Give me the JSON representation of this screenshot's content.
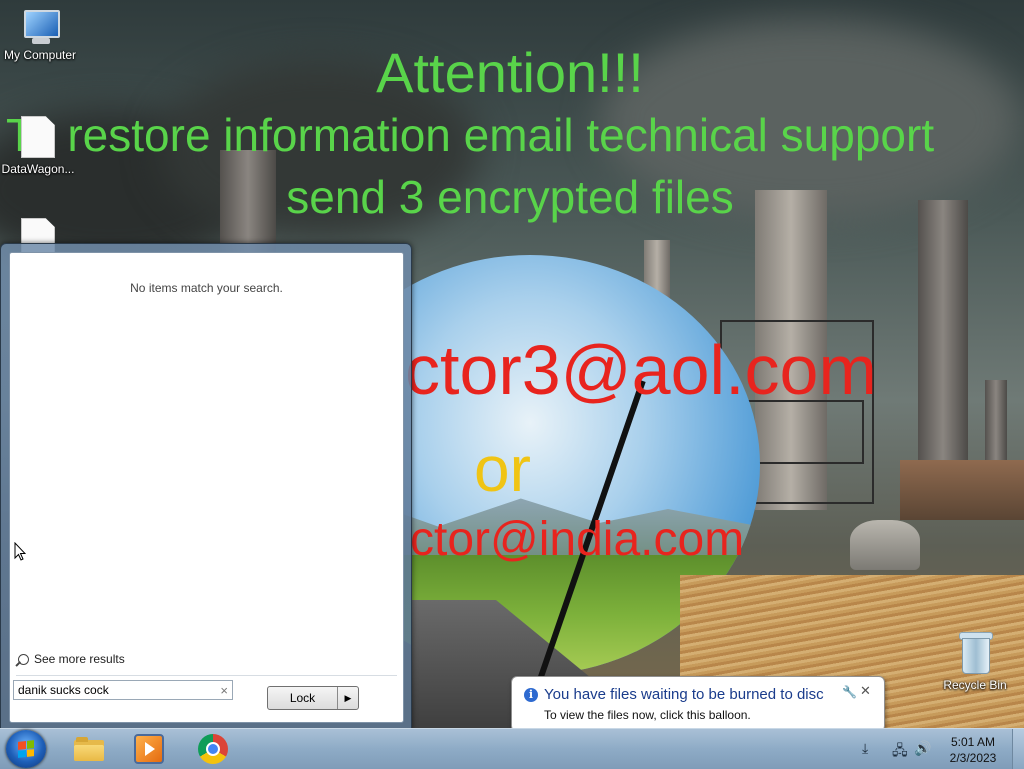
{
  "wallpaper": {
    "headline": "Attention!!!",
    "line2": "To restore information email technical support",
    "line3": "send 3 encrypted files",
    "email1": "ctor3@aol.com",
    "or": "or",
    "email2": "ctor@india.com",
    "colors": {
      "green": "#59d44a",
      "red": "#e8241e",
      "yellow": "#f0c414"
    }
  },
  "desktop": {
    "icons": [
      {
        "label": "My Computer",
        "icon": "computer-icon"
      },
      {
        "label": "DataWagon...",
        "icon": "document-icon"
      },
      {
        "label": "",
        "icon": "document-icon"
      },
      {
        "label": "Recycle Bin",
        "icon": "recycle-bin-icon"
      }
    ]
  },
  "start_menu": {
    "no_items": "No items match your search.",
    "see_more": "See more results",
    "search_value": "danik sucks cock",
    "power_button": "Lock"
  },
  "balloon": {
    "title": "You have files waiting to be burned to disc",
    "body": "To view the files now, click this balloon."
  },
  "taskbar": {
    "pinned": [
      "windows-explorer",
      "windows-media-player",
      "google-chrome"
    ],
    "clock_time": "5:01 AM",
    "clock_date": "2/3/2023"
  }
}
